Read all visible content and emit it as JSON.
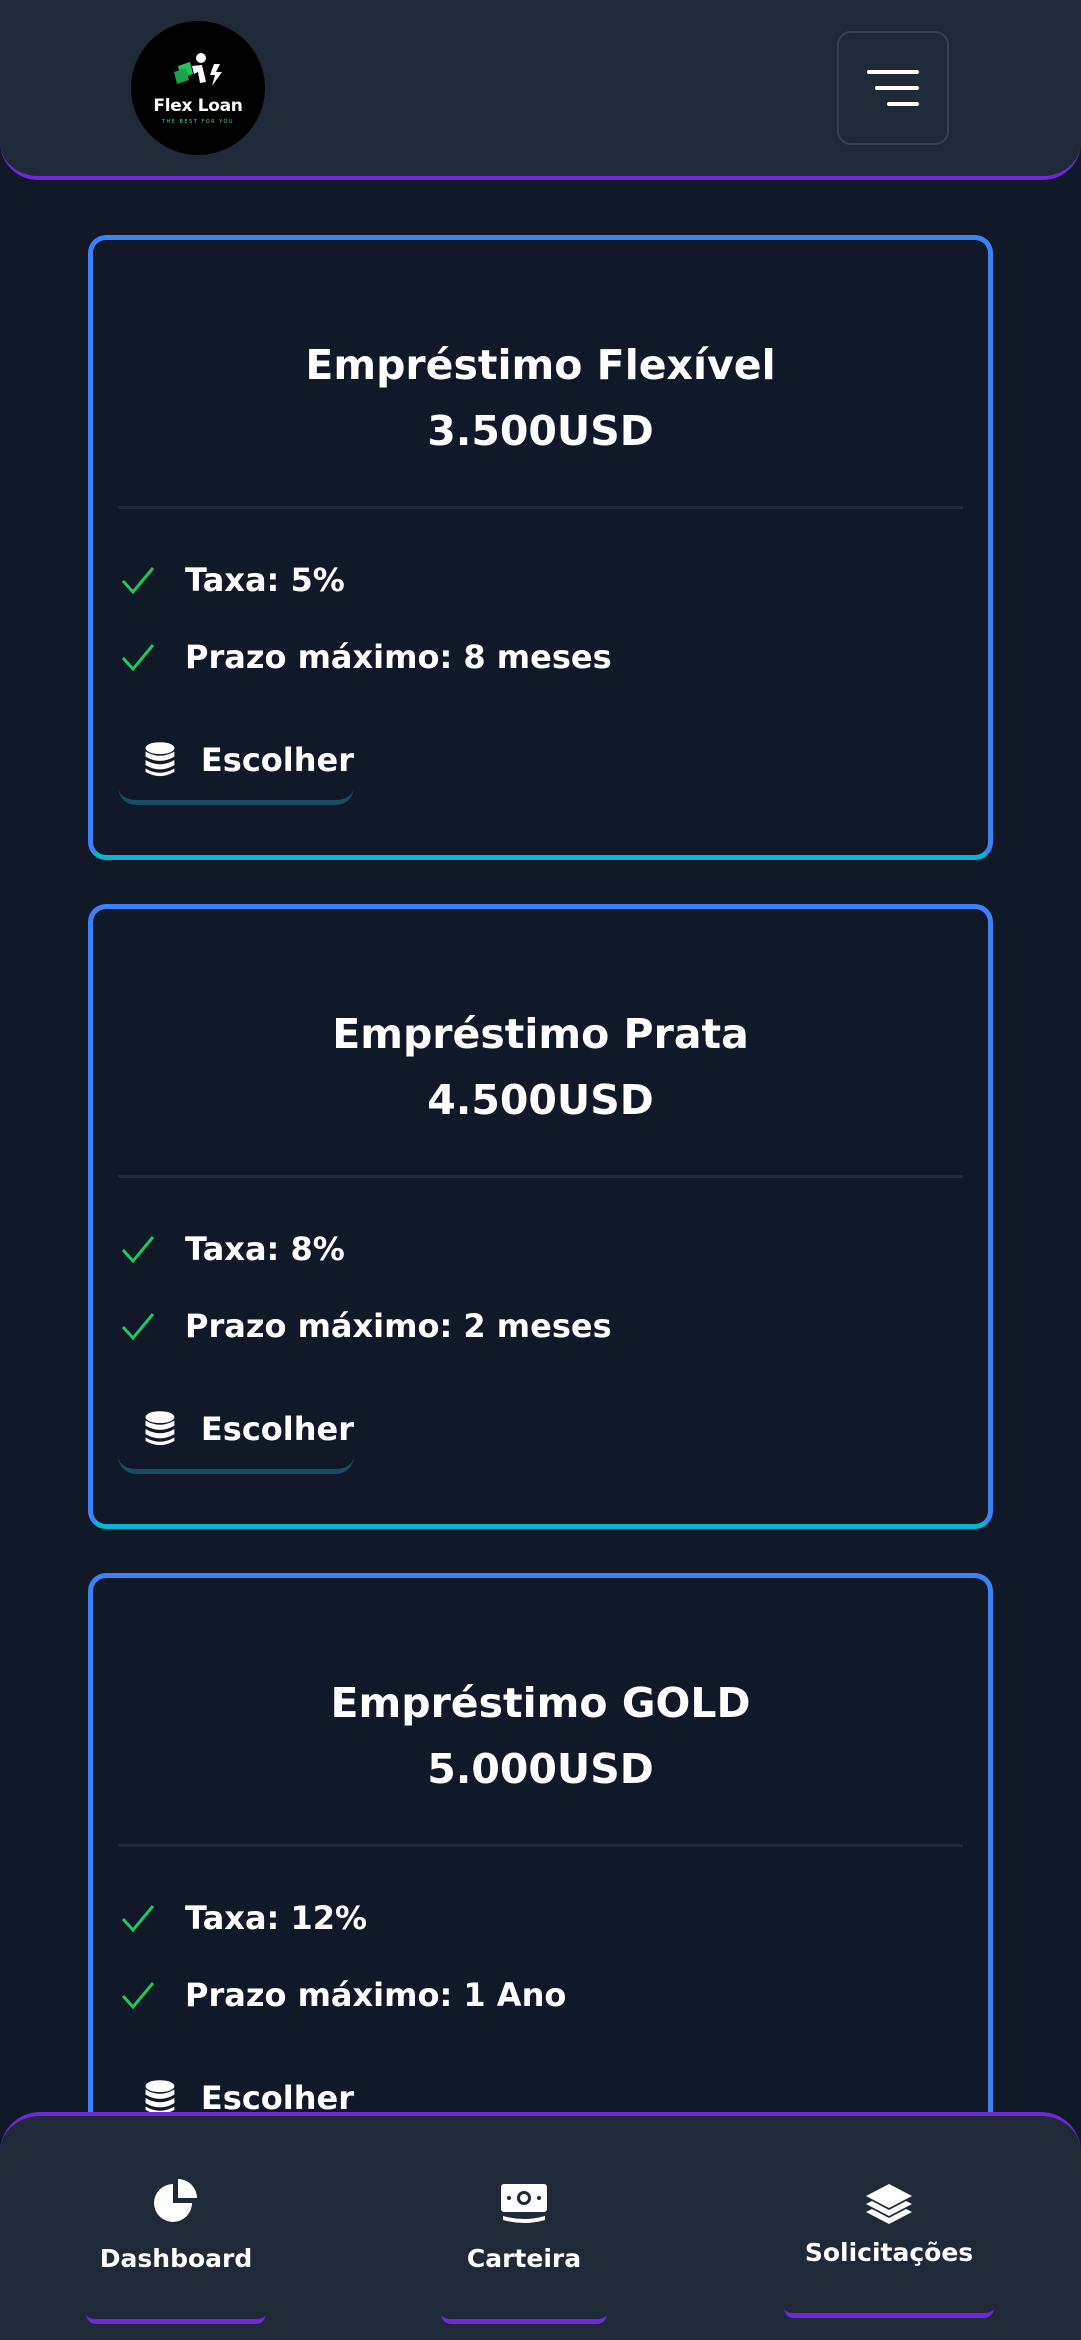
{
  "header": {
    "logo_name": "Flex Loan",
    "logo_tagline": "THE BEST FOR YOU"
  },
  "cards": [
    {
      "title": "Empréstimo Flexível",
      "price": "3.500USD",
      "features": [
        "Taxa: 5%",
        "Prazo máximo: 8 meses"
      ],
      "button_label": "Escolher"
    },
    {
      "title": "Empréstimo Prata",
      "price": "4.500USD",
      "features": [
        "Taxa: 8%",
        "Prazo máximo: 2 meses"
      ],
      "button_label": "Escolher"
    },
    {
      "title": "Empréstimo GOLD",
      "price": "5.000USD",
      "features": [
        "Taxa: 12%",
        "Prazo máximo: 1 Ano"
      ],
      "button_label": "Escolher"
    }
  ],
  "bottom_nav": {
    "items": [
      {
        "label": "Dashboard",
        "icon": "pie-chart-icon"
      },
      {
        "label": "Carteira",
        "icon": "cash-icon"
      },
      {
        "label": "Solicitações",
        "icon": "layers-icon"
      }
    ]
  },
  "colors": {
    "background": "#111827",
    "surface": "#1f2937",
    "card_border": "#3b82f6",
    "accent_purple": "#6d28d9",
    "check_green": "#22c55e"
  }
}
